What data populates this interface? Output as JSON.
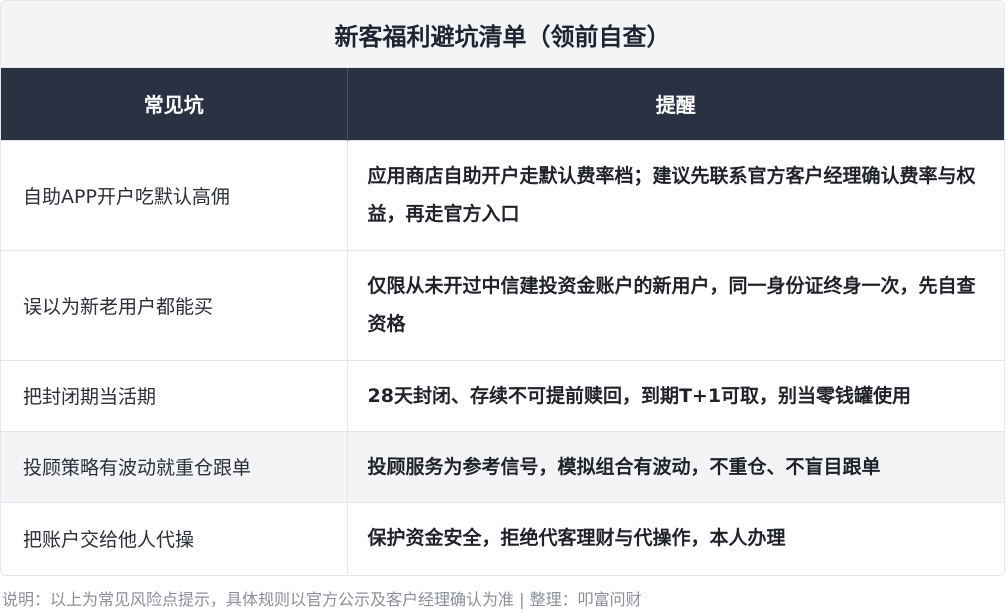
{
  "title": "新客福利避坑清单（领前自查）",
  "table": {
    "headers": [
      "常见坑",
      "提醒"
    ],
    "rows": [
      {
        "pit": "自助APP开户吃默认高佣",
        "tip": "应用商店自助开户走默认费率档；建议先联系官方客户经理确认费率与权益，再走官方入口"
      },
      {
        "pit": "误以为新老用户都能买",
        "tip": "仅限从未开过中信建投资金账户的新用户，同一身份证终身一次，先自查资格"
      },
      {
        "pit": "把封闭期当活期",
        "tip": "28天封闭、存续不可提前赎回，到期T+1可取，别当零钱罐使用"
      },
      {
        "pit": "投顾策略有波动就重仓跟单",
        "tip": "投顾服务为参考信号，模拟组合有波动，不重仓、不盲目跟单"
      },
      {
        "pit": "把账户交给他人代操",
        "tip": "保护资金安全，拒绝代客理财与代操作，本人办理"
      }
    ]
  },
  "footnote": "说明：以上为常见风险点提示，具体规则以官方公示及客户经理确认为准 | 整理：叩富问财",
  "colors": {
    "header_bg": "#2a3142",
    "title_bg": "#f3f4f6",
    "alt_row_bg": "#f3f4f6",
    "footnote_text": "#8a8f98"
  }
}
